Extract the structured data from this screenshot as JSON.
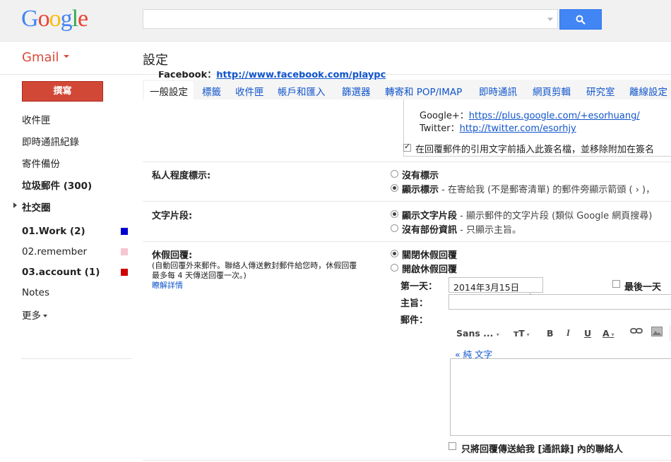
{
  "header": {
    "logo_letters": [
      {
        "ch": "G",
        "color": "#4285f4"
      },
      {
        "ch": "o",
        "color": "#ea4335"
      },
      {
        "ch": "o",
        "color": "#fbbc05"
      },
      {
        "ch": "g",
        "color": "#4285f4"
      },
      {
        "ch": "l",
        "color": "#34a853"
      },
      {
        "ch": "e",
        "color": "#ea4335"
      }
    ],
    "search_value": "",
    "search_icon": "search-icon"
  },
  "subbar": {
    "app_label": "Gmail",
    "page_title": "設定"
  },
  "sidebar": {
    "compose_label": "撰寫",
    "items": [
      {
        "label": "收件匣"
      },
      {
        "label": "即時通訊紀錄"
      },
      {
        "label": "寄件備份"
      },
      {
        "label": "垃圾郵件 (300)"
      },
      {
        "label": "社交圈"
      },
      {
        "label": "01.Work (2)",
        "color": "#0000cc"
      },
      {
        "label": "02.remember",
        "color": "#f6c5d0"
      },
      {
        "label": "03.account (1)",
        "color": "#cc0000"
      },
      {
        "label": "Notes"
      },
      {
        "label": "更多"
      }
    ]
  },
  "tabs": [
    "一般設定",
    "標籤",
    "收件匣",
    "帳戶和匯入",
    "篩選器",
    "轉寄和 POP/IMAP",
    "即時通訊",
    "網頁剪輯",
    "研究室",
    "離線設定"
  ],
  "signature": {
    "facebook_label": "Facebook：",
    "facebook_url": "http://www.facebook.com/playpc",
    "googleplus_label": "Google+：",
    "googleplus_url": "https://plus.google.com/+esorhuang/",
    "twitter_label": "Twitter：",
    "twitter_url": "http://twitter.com/esorhjy",
    "insert_checkbox_label": "在回覆郵件的引用文字前插入此簽名檔，並移除附加在簽名"
  },
  "privacy": {
    "label": "私人程度標示:",
    "option1": "沒有標示",
    "option2_title": "顯示標示",
    "option2_desc": " - 在寄給我 (不是郵寄清單) 的郵件旁顯示箭頭 ( › )，"
  },
  "snippets": {
    "label": "文字片段:",
    "option1_title": "顯示文字片段",
    "option1_desc": " - 顯示郵件的文字片段 (類似 Google 網頁搜尋)",
    "option2_title": "沒有部份資訊",
    "option2_desc": " - 只顯示主旨。"
  },
  "vacation": {
    "label": "休假回覆:",
    "desc_line1": "(自動回覆外來郵件。聯絡人傳送數封郵件給您時，休假回覆",
    "desc_line2": "最多每 4 天傳送回覆一次。)",
    "learn_more": "瞭解詳情",
    "off_label": "關閉休假回覆",
    "on_label": "開啟休假回覆",
    "first_day_label": "第一天：",
    "first_day_value": "2014年3月15日",
    "last_day_label": "最後一天",
    "subject_label": "主旨：",
    "subject_value": "",
    "message_label": "郵件：",
    "font_label": "Sans ...",
    "plain_text_link": "« 純 文字",
    "contacts_only_label": "只將回覆傳送給我 [通訊錄] 內的聯絡人"
  }
}
